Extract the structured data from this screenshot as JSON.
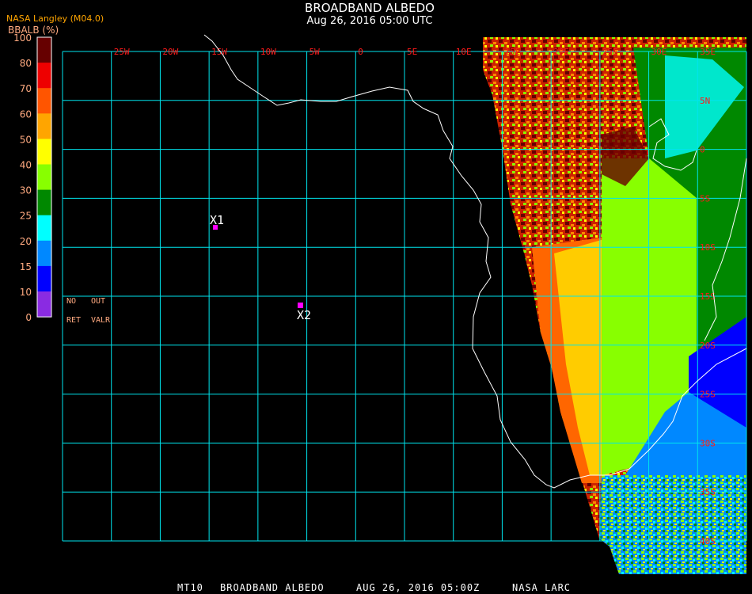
{
  "header": {
    "title": "BROADBAND ALBEDO",
    "subtitle": "Aug 26, 2016 05:00 UTC",
    "source": "NASA Langley (M04.0)"
  },
  "legend": {
    "title": "BBALB (%)",
    "ticks": [
      "100",
      "80",
      "70",
      "60",
      "50",
      "40",
      "30",
      "25",
      "20",
      "15",
      "10",
      "0"
    ],
    "colors": [
      "#660000",
      "#ee0000",
      "#ff5500",
      "#ffa500",
      "#ffff00",
      "#88ff00",
      "#008800",
      "#00ffff",
      "#0088ff",
      "#0000ff",
      "#8a2be2"
    ]
  },
  "notes": {
    "no": "NO",
    "out": "OUT",
    "ret": "RET",
    "valr": "VALR"
  },
  "grid": {
    "lon_labels": [
      "25W",
      "20W",
      "15W",
      "10W",
      "5W",
      "0",
      "5E",
      "10E",
      "15E",
      "20E",
      "25E",
      "30E",
      "35E"
    ],
    "lat_labels": [
      "5N",
      "0",
      "5S",
      "10S",
      "15S",
      "20S",
      "25S",
      "30S",
      "35S",
      "40S"
    ],
    "line_color": "#00e5ee"
  },
  "markers": [
    {
      "label": "X1",
      "color": "#ff00ff"
    },
    {
      "label": "X2",
      "color": "#ff00ff"
    }
  ],
  "footer": {
    "product": "MT10",
    "name": "BROADBAND ALBEDO",
    "datetime": "AUG 26, 2016 05:00Z",
    "org": "NASA LARC"
  }
}
